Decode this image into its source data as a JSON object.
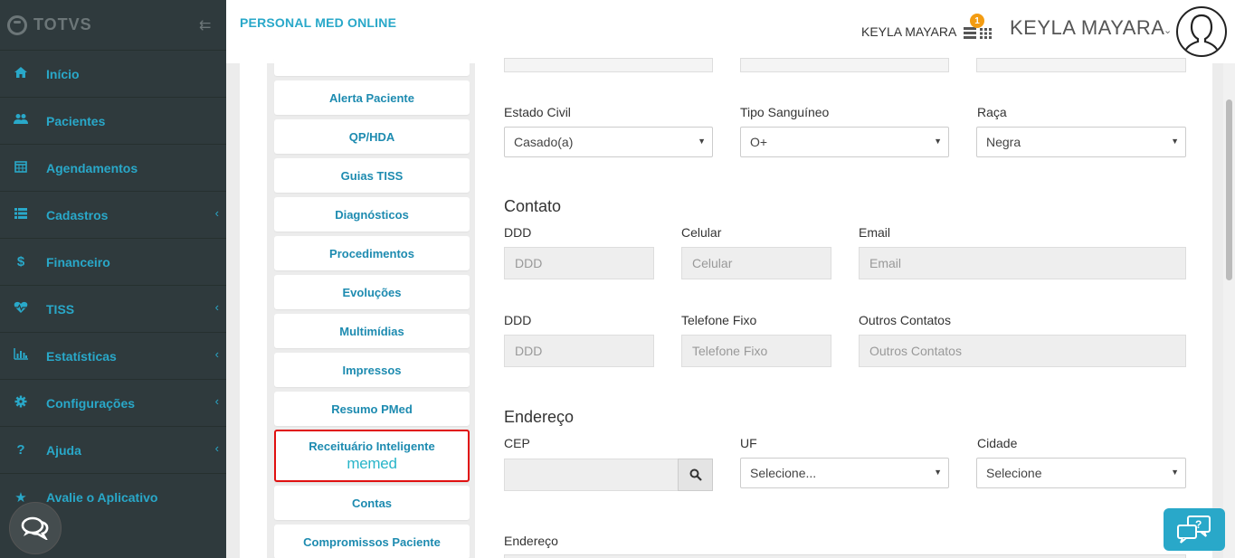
{
  "sidebar": {
    "logo": "TOTVS",
    "items": [
      {
        "label": "Início",
        "icon": "home-icon",
        "chevron": false
      },
      {
        "label": "Pacientes",
        "icon": "users-icon",
        "chevron": false
      },
      {
        "label": "Agendamentos",
        "icon": "calendar-icon",
        "chevron": false
      },
      {
        "label": "Cadastros",
        "icon": "list-icon",
        "chevron": true
      },
      {
        "label": "Financeiro",
        "icon": "dollar-icon",
        "chevron": false
      },
      {
        "label": "TISS",
        "icon": "heartbeat-icon",
        "chevron": true
      },
      {
        "label": "Estatísticas",
        "icon": "bar-chart-icon",
        "chevron": true
      },
      {
        "label": "Configurações",
        "icon": "gear-icon",
        "chevron": true
      },
      {
        "label": "Ajuda",
        "icon": "question-icon",
        "chevron": true
      },
      {
        "label": "Avalie o Aplicativo",
        "icon": "star-icon",
        "chevron": false
      }
    ]
  },
  "header": {
    "app_title": "PERSONAL MED ONLINE",
    "user_small": "KEYLA MAYARA",
    "notification_count": "1",
    "user_big": "KEYLA MAYARA"
  },
  "left_menu": {
    "items": [
      "Alerta Paciente",
      "QP/HDA",
      "Guias TISS",
      "Diagnósticos",
      "Procedimentos",
      "Evoluções",
      "Multimídias",
      "Impressos",
      "Resumo PMed"
    ],
    "highlight_label": "Receituário Inteligente",
    "highlight_brand": "memed",
    "after_items": [
      "Contas",
      "Compromissos Paciente"
    ]
  },
  "form": {
    "estado_civil_label": "Estado Civil",
    "estado_civil_value": "Casado(a)",
    "tipo_sanguineo_label": "Tipo Sanguíneo",
    "tipo_sanguineo_value": "O+",
    "raca_label": "Raça",
    "raca_value": "Negra",
    "contato_title": "Contato",
    "ddd_label": "DDD",
    "ddd_placeholder": "DDD",
    "celular_label": "Celular",
    "celular_placeholder": "Celular",
    "email_label": "Email",
    "email_placeholder": "Email",
    "ddd2_label": "DDD",
    "ddd2_placeholder": "DDD",
    "telefone_label": "Telefone Fixo",
    "telefone_placeholder": "Telefone Fixo",
    "outros_label": "Outros Contatos",
    "outros_placeholder": "Outros Contatos",
    "endereco_title": "Endereço",
    "cep_label": "CEP",
    "uf_label": "UF",
    "uf_value": "Selecione...",
    "cidade_label": "Cidade",
    "cidade_value": "Selecione",
    "endereco_label": "Endereço"
  }
}
